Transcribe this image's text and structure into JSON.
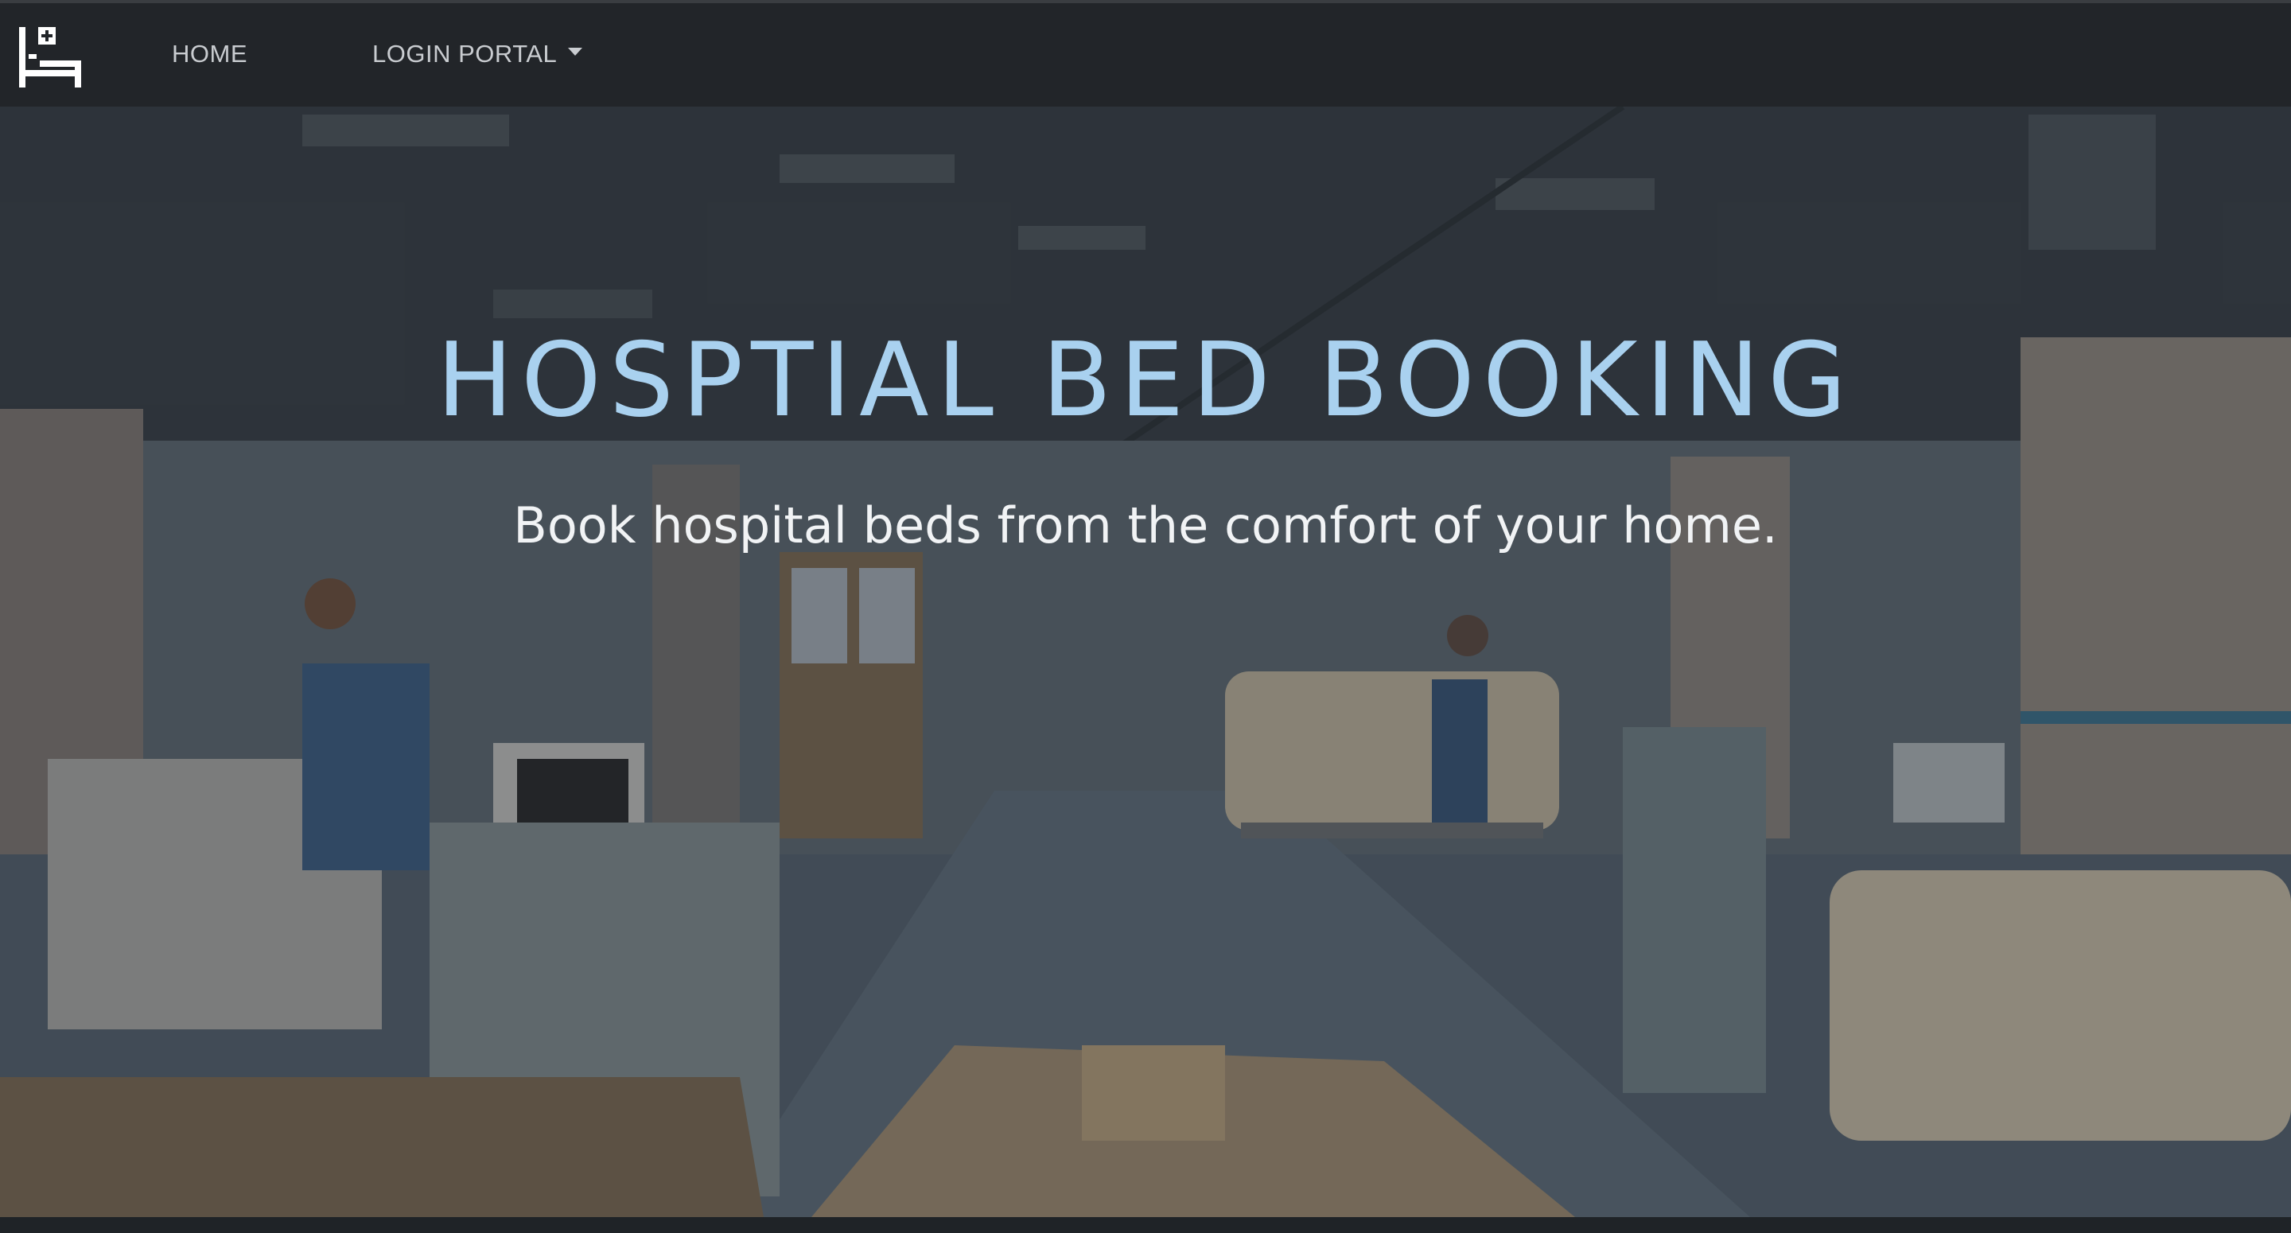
{
  "navbar": {
    "logo_icon": "hospital-bed-icon",
    "links": [
      {
        "label": "HOME"
      },
      {
        "label": "LOGIN PORTAL",
        "dropdown_icon": "caret-down-icon"
      }
    ]
  },
  "hero": {
    "title": "HOSPTIAL BED BOOKING",
    "subtitle": "Book hospital beds from the comfort of your home.",
    "background_image": "hospital-ward-photo",
    "title_color": "#a9d1ef"
  }
}
